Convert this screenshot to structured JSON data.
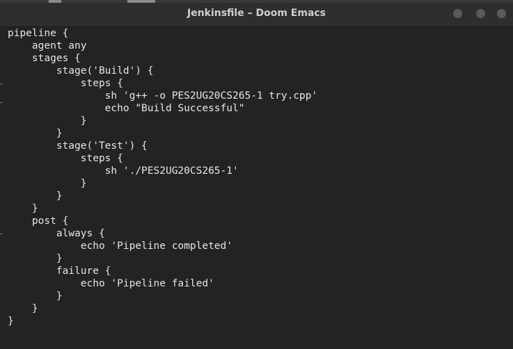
{
  "window": {
    "title": "Jenkinsfile – Doom Emacs"
  },
  "editor": {
    "lines": [
      "pipeline {",
      "    agent any",
      "    stages {",
      "        stage('Build') {",
      "            steps {",
      "                sh 'g++ -o PES2UG20CS265-1 try.cpp'",
      "                echo \"Build Successful\"",
      "            }",
      "        }",
      "        stage('Test') {",
      "            steps {",
      "                sh './PES2UG20CS265-1'",
      "            }",
      "        }",
      "    }",
      "    post {",
      "        always {",
      "            echo 'Pipeline completed'",
      "        }",
      "        failure {",
      "            echo 'Pipeline failed'",
      "        }",
      "    }",
      "}"
    ]
  }
}
